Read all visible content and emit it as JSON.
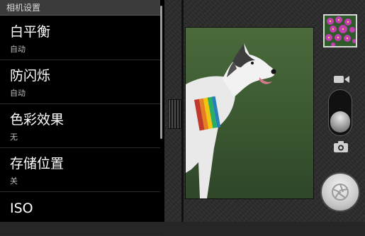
{
  "settings": {
    "header": "相机设置",
    "items": [
      {
        "label": "白平衡",
        "value": "自动"
      },
      {
        "label": "防闪烁",
        "value": "自动"
      },
      {
        "label": "色彩效果",
        "value": "无"
      },
      {
        "label": "存储位置",
        "value": "关"
      },
      {
        "label": "ISO",
        "value": ""
      }
    ]
  },
  "icons": {
    "video_mode": "video-camera-icon",
    "photo_mode": "camera-icon",
    "shutter": "aperture-icon"
  },
  "colors": {
    "panel_background": "#000000",
    "header_background": "#3b3b3b",
    "primary_text": "#ffffff",
    "secondary_text": "#bdbdbd"
  }
}
